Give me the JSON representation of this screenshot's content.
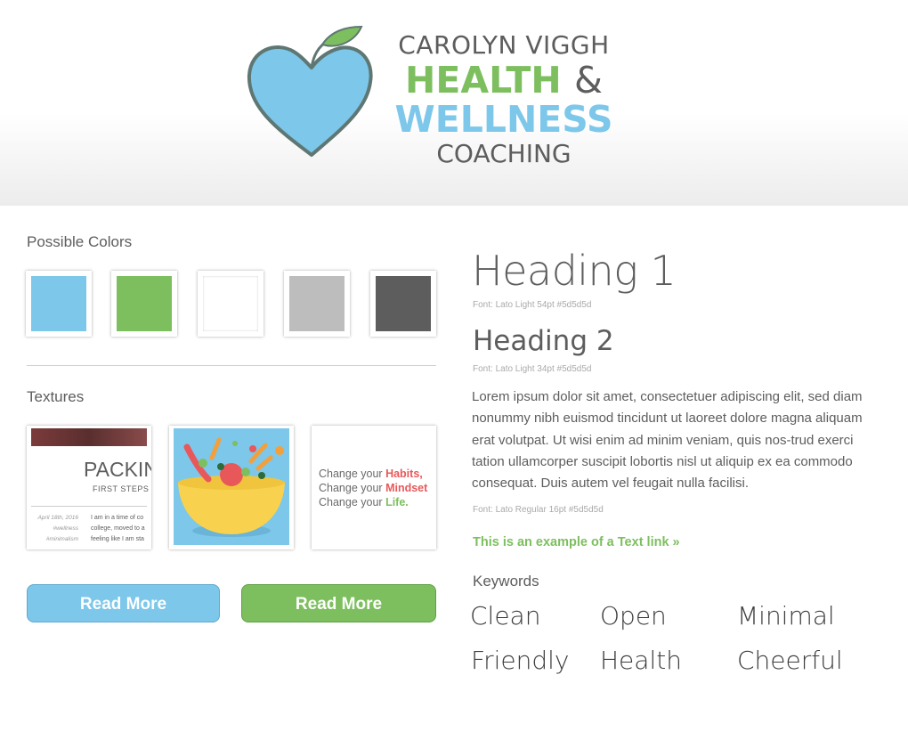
{
  "logo": {
    "name_line": "CAROLYN VIGGH",
    "health": "HEALTH",
    "ampersand": "&",
    "wellness": "WELLNESS",
    "coaching": "COACHING"
  },
  "colors_section": {
    "label": "Possible Colors",
    "swatches": [
      "#7cc7ea",
      "#7dbf5f",
      "#ffffff",
      "#bdbdbd",
      "#5d5d5d"
    ]
  },
  "textures_section": {
    "label": "Textures",
    "tile1": {
      "title": "PACKIN",
      "subtitle": "FIRST STEPS",
      "date": "April 18th, 2016",
      "tag1": "#wellness",
      "tag2": "#minimalism",
      "body1": "I am in a time of co",
      "body2": "college, moved to a",
      "body3": "feeling like I am sta"
    },
    "tile3": {
      "line1_prefix": "Change your ",
      "line1_word": "Habits,",
      "line2_prefix": "Change your ",
      "line2_word": "Mindset",
      "line3_prefix": "Change your ",
      "line3_word": "Life."
    }
  },
  "buttons": {
    "blue_label": "Read More",
    "green_label": "Read More"
  },
  "typography": {
    "heading1": "Heading 1",
    "heading1_note": "Font: Lato Light 54pt #5d5d5d",
    "heading2": "Heading 2",
    "heading2_note": "Font: Lato Light 34pt #5d5d5d",
    "body": "Lorem ipsum dolor sit amet, consectetuer adipiscing elit, sed diam nonummy nibh euismod tincidunt ut laoreet dolore magna aliquam erat volutpat. Ut wisi enim ad minim veniam, quis nos-trud exerci tation ullamcorper suscipit lobortis nisl ut aliquip ex ea commodo consequat. Duis autem vel feugait nulla facilisi.",
    "body_note": "Font: Lato Regular 16pt #5d5d5d",
    "text_link": "This is an example of a Text link »"
  },
  "keywords": {
    "label": "Keywords",
    "items": [
      "Clean",
      "Open",
      "Minimal",
      "Friendly",
      "Health",
      "Cheerful"
    ]
  }
}
